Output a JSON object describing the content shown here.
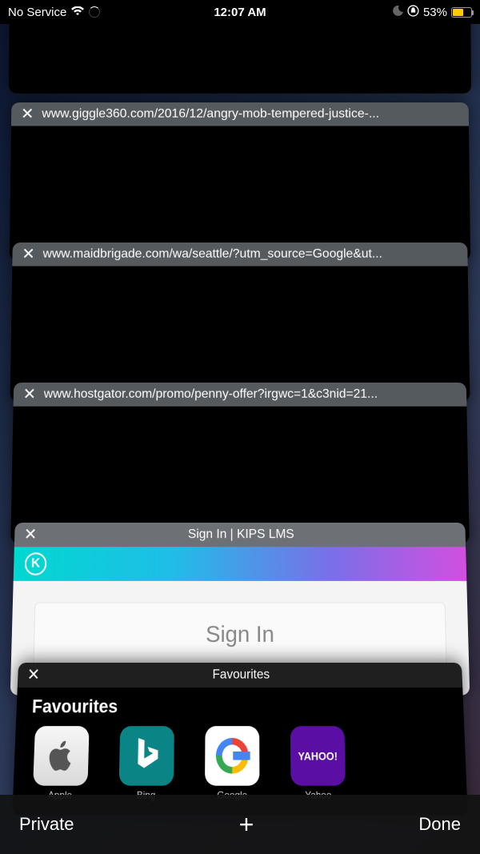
{
  "status": {
    "service": "No Service",
    "time": "12:07 AM",
    "battery_pct": "53%"
  },
  "tabs": [
    {
      "title": "www.giggle360.com/2016/12/angry-mob-tempered-justice-..."
    },
    {
      "title": "www.maidbrigade.com/wa/seattle/?utm_source=Google&ut..."
    },
    {
      "title": "www.hostgator.com/promo/penny-offer?irgwc=1&c3nid=21..."
    },
    {
      "title": "Sign In | KIPS LMS",
      "kips_signin": "Sign In"
    },
    {
      "title": "Favourites"
    }
  ],
  "favourites": {
    "heading": "Favourites",
    "items": [
      {
        "label": "Apple"
      },
      {
        "label": "Bing"
      },
      {
        "label": "Google"
      },
      {
        "label": "Yahoo"
      }
    ]
  },
  "toolbar": {
    "private": "Private",
    "done": "Done"
  }
}
